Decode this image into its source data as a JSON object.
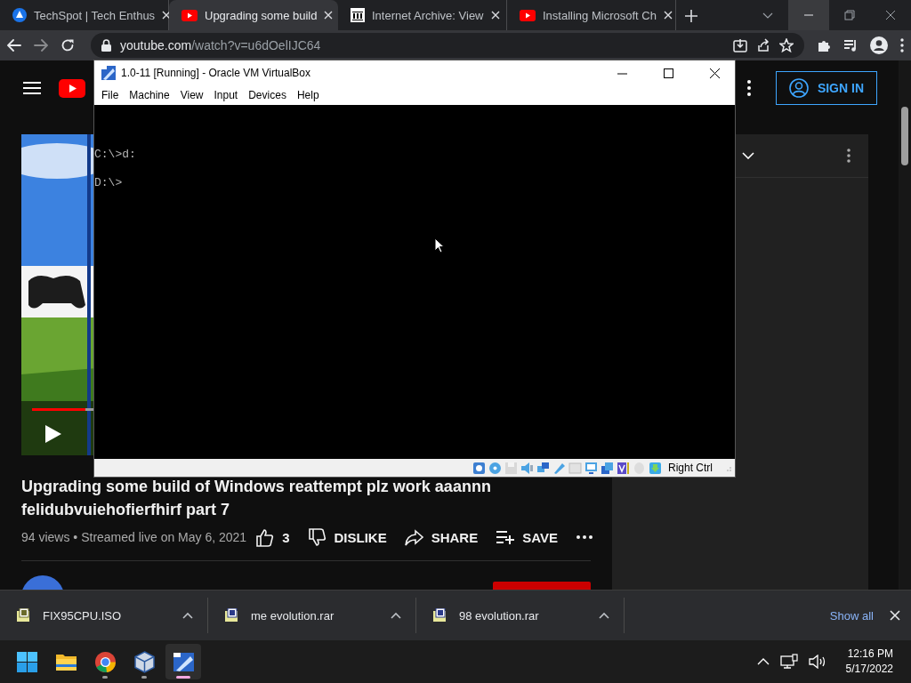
{
  "browser": {
    "tabs": [
      {
        "kind": "techspot",
        "title": "TechSpot | Tech Enthus",
        "selected": false
      },
      {
        "kind": "youtube",
        "title": "Upgrading some build",
        "selected": true
      },
      {
        "kind": "archive",
        "title": "Internet Archive: View",
        "selected": false
      },
      {
        "kind": "youtube",
        "title": "Installing Microsoft Ch",
        "selected": false
      }
    ],
    "address": {
      "domain": "youtube.com",
      "path": "/watch?v=u6dOelIJC64"
    }
  },
  "youtube": {
    "sign_in": "SIGN IN",
    "video": {
      "title": "Upgrading some build of Windows reattempt plz work aaannn felidubvuiehofierfhirf part 7",
      "meta": "94 views • Streamed live on May 6, 2021",
      "actions": [
        {
          "kind": "like",
          "label": "3"
        },
        {
          "kind": "dislike",
          "label": "DISLIKE"
        },
        {
          "kind": "share",
          "label": "SHARE"
        },
        {
          "kind": "save",
          "label": "SAVE"
        },
        {
          "kind": "more"
        }
      ]
    }
  },
  "virtualbox": {
    "title": "1.0-11 [Running] - Oracle VM VirtualBox",
    "menu": [
      "File",
      "Machine",
      "View",
      "Input",
      "Devices",
      "Help"
    ],
    "console": [
      "C:\\>d:",
      "D:\\>"
    ],
    "host_key": "Right Ctrl"
  },
  "downloads": {
    "items": [
      {
        "kind": "iso",
        "name": "FIX95CPU.ISO"
      },
      {
        "kind": "rar",
        "name": "me evolution.rar"
      },
      {
        "kind": "rar",
        "name": "98 evolution.rar"
      }
    ],
    "show_all": "Show all"
  },
  "taskbar": {
    "apps": [
      {
        "kind": "start",
        "running": false,
        "active": false
      },
      {
        "kind": "explorer",
        "running": false,
        "active": false
      },
      {
        "kind": "chrome",
        "running": true,
        "active": false
      },
      {
        "kind": "virtualbox",
        "running": true,
        "active": false
      },
      {
        "kind": "vm",
        "running": true,
        "active": true
      }
    ],
    "time": "12:16 PM",
    "date": "5/17/2022"
  }
}
